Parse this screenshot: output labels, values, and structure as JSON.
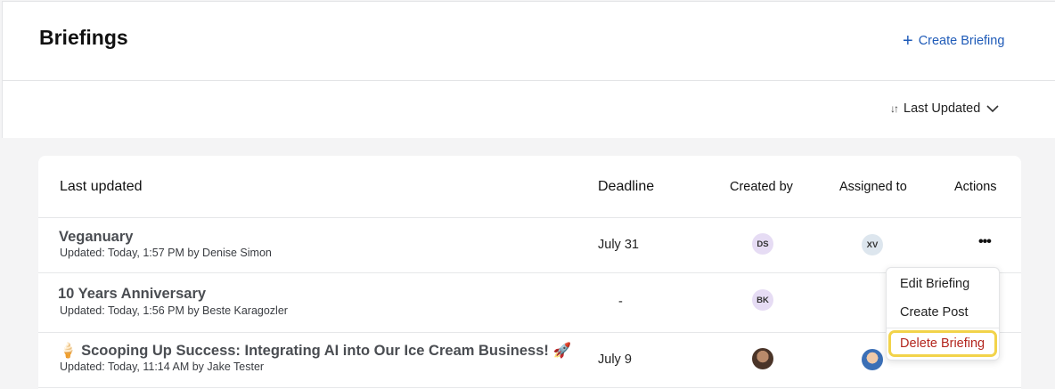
{
  "header": {
    "title": "Briefings",
    "create_label": "Create Briefing",
    "create_icon": "plus-icon"
  },
  "sort": {
    "label": "Last Updated",
    "sort_icon": "sort-arrows-icon",
    "chevron_icon": "chevron-down-icon"
  },
  "table": {
    "columns": [
      "Last updated",
      "Deadline",
      "Created by",
      "Assigned to",
      "Actions"
    ],
    "rows": [
      {
        "title": "Veganuary",
        "subtitle": "Updated: Today, 1:57 PM by Denise Simon",
        "deadline": "July 31",
        "created_by": "DS",
        "assigned_to": "XV"
      },
      {
        "title": "10 Years Anniversary",
        "subtitle": "Updated: Today, 1:56 PM by Beste Karagozler",
        "deadline": "-",
        "created_by": "BK",
        "assigned_to": ""
      },
      {
        "title": "🍦 Scooping Up Success: Integrating AI into Our Ice Cream Business! 🚀",
        "subtitle": "Updated: Today, 11:14 AM by Jake Tester",
        "deadline": "July 9",
        "created_by": "photo",
        "assigned_to": "photo"
      }
    ]
  },
  "actions_menu": {
    "items": [
      "Edit Briefing",
      "Create Post",
      "Delete Briefing"
    ],
    "highlight_color": "#f2d34a",
    "danger_color": "#b3261e"
  },
  "colors": {
    "accent": "#1f5bb8",
    "avatar_purple": "#e6dcf4",
    "avatar_blue": "#dde6ee"
  }
}
